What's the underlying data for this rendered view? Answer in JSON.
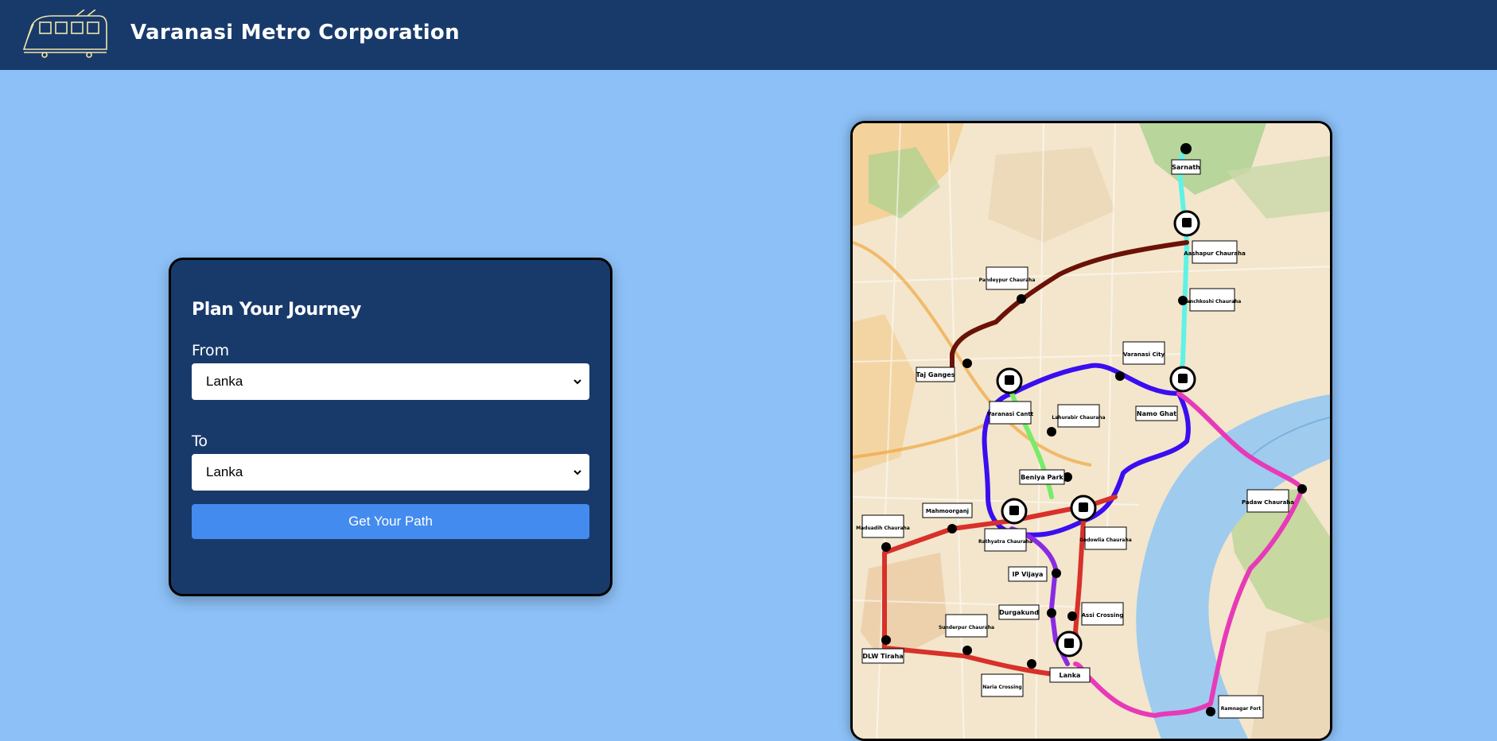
{
  "header": {
    "title": "Varanasi Metro Corporation",
    "logo_icon": "metro-train-icon"
  },
  "journey": {
    "heading": "Plan Your Journey",
    "from_label": "From",
    "from_value": "Lanka",
    "to_label": "To",
    "to_value": "Lanka",
    "button_label": "Get Your Path"
  },
  "map": {
    "stations": [
      "Sarnath",
      "Aashapur Chauraha",
      "Panchkoshi Chauraha",
      "Pandeypur Chauraha",
      "Taj Ganges",
      "Varanasi Cantt",
      "Varanasi City",
      "Namo Ghat",
      "Lahurabir Chauraha",
      "Beniya Park",
      "Padaw Chauraha",
      "Mahmoorganj",
      "Maduadih Chauraha",
      "Rathyatra Chauraha",
      "Godowlia Chauraha",
      "IP Vijaya",
      "Durgakund",
      "Assi Crossing",
      "Sunderpur Chauraha",
      "DLW Tiraha",
      "Lanka",
      "Naria Crossing",
      "Ramnagar Fort"
    ],
    "line_colors": {
      "aqua": "#5ff2e6",
      "brown": "#6b1208",
      "blue": "#3a0ef0",
      "green": "#78ec6a",
      "red": "#d8302a",
      "purple": "#8a2be2",
      "pink": "#e83ab8"
    }
  }
}
